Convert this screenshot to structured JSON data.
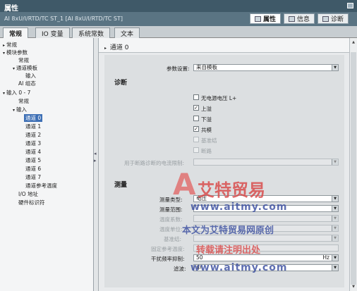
{
  "window": {
    "title": "属性",
    "subtitle": "AI 8xU/I/RTD/TC ST_1 [AI 8xU/I/RTD/TC ST]"
  },
  "right_tabs": [
    {
      "label": "属性",
      "icon": "properties-icon"
    },
    {
      "label": "信息",
      "icon": "info-icon"
    },
    {
      "label": "诊断",
      "icon": "diagnostics-icon"
    }
  ],
  "tabs": [
    {
      "label": "常规"
    },
    {
      "label": "IO 变量"
    },
    {
      "label": "系统常数"
    },
    {
      "label": "文本"
    }
  ],
  "nav": {
    "items": [
      {
        "label": "常规"
      },
      {
        "label": "模块参数"
      },
      {
        "label": "常规"
      },
      {
        "label": "通道模板"
      },
      {
        "label": "输入"
      },
      {
        "label": "AI 组态"
      },
      {
        "label": "输入 0 - 7"
      },
      {
        "label": "常规"
      },
      {
        "label": "输入"
      },
      {
        "label": "通道 0"
      },
      {
        "label": "通道 1"
      },
      {
        "label": "通道 2"
      },
      {
        "label": "通道 3"
      },
      {
        "label": "通道 4"
      },
      {
        "label": "通道 5"
      },
      {
        "label": "通道 6"
      },
      {
        "label": "通道 7"
      },
      {
        "label": "通道参考温度"
      },
      {
        "label": "I/O 地址"
      },
      {
        "label": "硬件标识符"
      }
    ]
  },
  "section": {
    "title": "通道 0",
    "param_label": "参数设置:",
    "param_value": "来自模板"
  },
  "diagnostics": {
    "title": "诊断",
    "items": [
      {
        "label": "无电源电压 L+",
        "checked": false,
        "enabled": true
      },
      {
        "label": "上溢",
        "checked": true,
        "enabled": true
      },
      {
        "label": "下溢",
        "checked": false,
        "enabled": true
      },
      {
        "label": "共模",
        "checked": true,
        "enabled": true
      },
      {
        "label": "基准结",
        "checked": false,
        "enabled": false
      },
      {
        "label": "断路",
        "checked": false,
        "enabled": false
      }
    ],
    "wire_break_label": "用于断路诊断的电流限制:"
  },
  "measurement": {
    "title": "测量",
    "rows": [
      {
        "label": "测量类型:",
        "value": "电压",
        "enabled": true
      },
      {
        "label": "测量范围:",
        "value": "",
        "enabled": true
      },
      {
        "label": "温度系数:",
        "value": "",
        "enabled": false
      },
      {
        "label": "温度单位:",
        "value": "",
        "enabled": false
      },
      {
        "label": "基准结:",
        "value": "",
        "enabled": false
      },
      {
        "label": "固定参考温度:",
        "value": "",
        "enabled": false
      },
      {
        "label": "干扰频率抑制:",
        "value": "50",
        "unit": "Hz",
        "enabled": true
      },
      {
        "label": "滤波:",
        "value": "中",
        "enabled": true
      }
    ]
  },
  "watermark": {
    "brand": "艾特贸易",
    "url": "www.aitmy.com",
    "line1": "本文为艾特贸易网原创",
    "line2": "转载请注明出处",
    "url2": "www.aitmy.com",
    "logo_letter": "A",
    "color_red": "#d94848",
    "color_blue": "#3b4fa0"
  }
}
